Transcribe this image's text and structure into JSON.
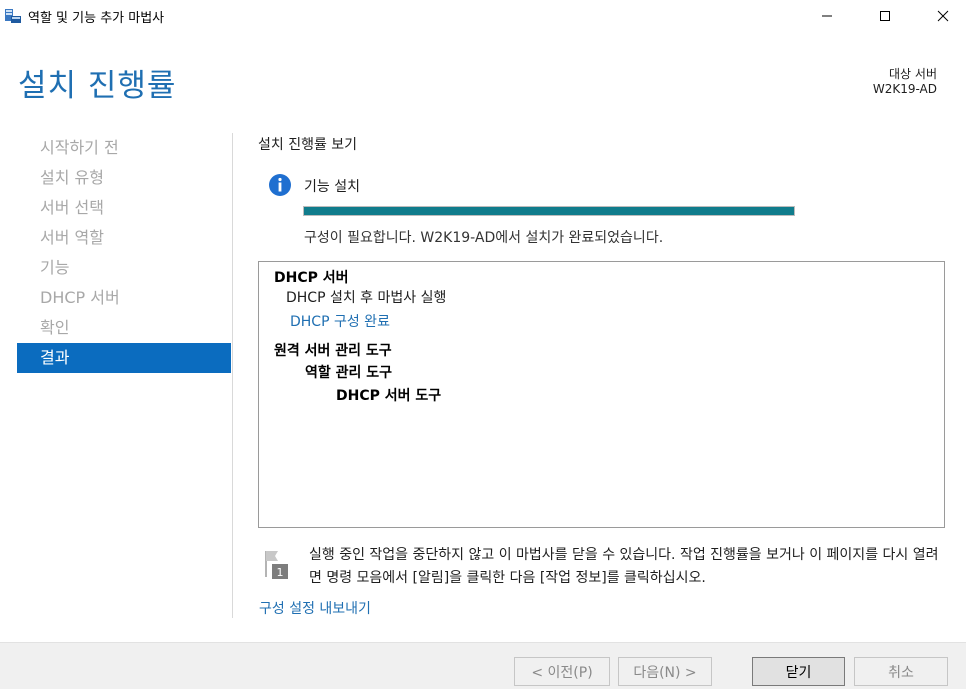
{
  "window": {
    "title": "역할 및 기능 추가 마법사"
  },
  "header": {
    "title": "설치 진행률",
    "destination_label": "대상 서버",
    "destination_value": "W2K19-AD"
  },
  "nav": {
    "items": [
      {
        "label": "시작하기 전",
        "active": false
      },
      {
        "label": "설치 유형",
        "active": false
      },
      {
        "label": "서버 선택",
        "active": false
      },
      {
        "label": "서버 역할",
        "active": false
      },
      {
        "label": "기능",
        "active": false
      },
      {
        "label": "DHCP 서버",
        "active": false
      },
      {
        "label": "확인",
        "active": false
      },
      {
        "label": "결과",
        "active": true
      }
    ]
  },
  "content": {
    "section_title": "설치 진행률 보기",
    "feature_label": "기능 설치",
    "progress": 1.0,
    "status_text": "구성이 필요합니다. W2K19-AD에서 설치가 완료되었습니다.",
    "results": {
      "dhcp_server": "DHCP 서버",
      "dhcp_postinstall": "DHCP 설치 후 마법사 실행",
      "dhcp_config_link": "DHCP 구성 완료",
      "rsat": "원격 서버 관리 도구",
      "role_admin_tools": "역할 관리 도구",
      "dhcp_tools": "DHCP 서버 도구"
    },
    "note": "실행 중인 작업을 중단하지 않고 이 마법사를 닫을 수 있습니다. 작업 진행률을 보거나 이 페이지를 다시 열려면 명령 모음에서 [알림]을 클릭한 다음 [작업 정보]를 클릭하십시오.",
    "flag_badge": "1",
    "export_link": "구성 설정 내보내기"
  },
  "footer": {
    "prev": "< 이전(P)",
    "next": "다음(N) >",
    "close": "닫기",
    "cancel": "취소"
  },
  "colors": {
    "accent": "#0b6cbf",
    "progress": "#107c8c",
    "link": "#1f6fb2"
  }
}
